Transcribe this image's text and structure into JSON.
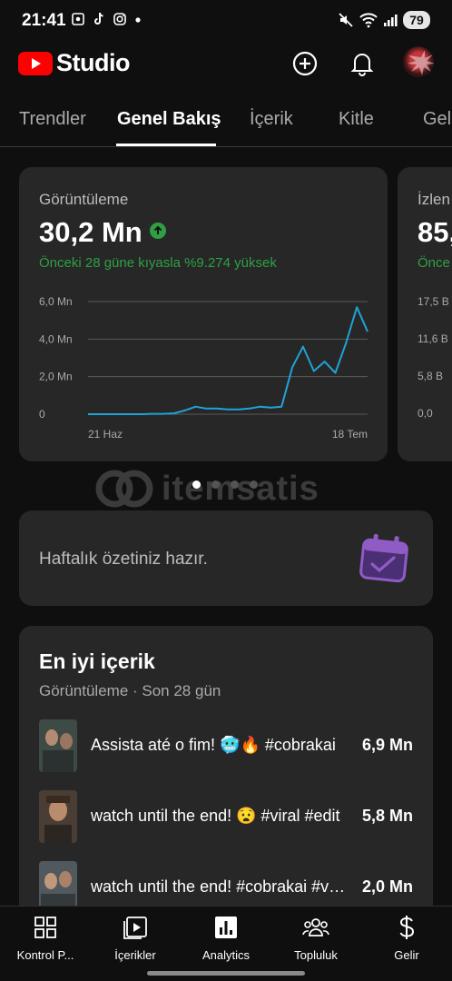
{
  "status_bar": {
    "time": "21:41",
    "battery": "79",
    "left_icons": [
      "screenshot-icon",
      "tiktok-icon",
      "instagram-icon",
      "dot-icon"
    ],
    "right_icons": [
      "mute-icon",
      "wifi-icon",
      "signal-icon"
    ]
  },
  "header": {
    "logo_text": "Studio",
    "brand_color": "#ff0000",
    "actions": [
      "create-icon",
      "notifications-icon",
      "avatar"
    ]
  },
  "tabs": [
    "Trendler",
    "Genel Bakış",
    "İçerik",
    "Kitle",
    "Gel"
  ],
  "active_tab": "Genel Bakış",
  "metric_card": {
    "label": "Görüntüleme",
    "value": "30,2 Mn",
    "trend_icon": "arrow-up-icon",
    "compare_text": "Önceki 28 güne kıyasla %9.274 yüksek",
    "accent_color": "#2ea043"
  },
  "peek_card": {
    "label": "İzlen",
    "value": "85,",
    "compare_text": "Önce",
    "ticks": [
      "17,5 B",
      "11,6 B",
      "5,8 B",
      "0,0"
    ]
  },
  "chart_data": {
    "type": "line",
    "color": "#1fa3d6",
    "grid": true,
    "y_ticks": [
      "6,0 Mn",
      "4,0 Mn",
      "2,0 Mn",
      "0"
    ],
    "ylim": [
      0,
      6.0
    ],
    "x_tick_labels": [
      "21 Haz",
      "18 Tem"
    ],
    "series": [
      {
        "values": [
          0.0,
          0.0,
          0.0,
          0.0,
          0.0,
          0.0,
          0.02,
          0.02,
          0.05,
          0.2,
          0.4,
          0.3,
          0.3,
          0.25,
          0.25,
          0.3,
          0.4,
          0.35,
          0.4,
          2.5,
          3.6,
          2.3,
          2.8,
          2.2,
          3.8,
          5.7,
          4.4
        ]
      }
    ]
  },
  "pager": {
    "count": 4,
    "active": 0
  },
  "watermark": "itemsatis",
  "summary": {
    "text": "Haftalık özetiniz hazır.",
    "icon": "calendar-check-icon",
    "icon_color": "#8e5cc4"
  },
  "top_content": {
    "title": "En iyi içerik",
    "subtitle": "Görüntüleme · Son 28 gün",
    "rows": [
      {
        "title": "Assista até o fim! 🥶🔥 #cobrakai",
        "value": "6,9 Mn"
      },
      {
        "title": "watch until the end! 😧 #viral #edit",
        "value": "5,8 Mn"
      },
      {
        "title": "watch until the end! #cobrakai #viral",
        "value": "2,0 Mn"
      }
    ]
  },
  "bottom_nav": [
    {
      "label": "Kontrol P...",
      "icon": "dashboard-icon"
    },
    {
      "label": "İçerikler",
      "icon": "content-icon"
    },
    {
      "label": "Analytics",
      "icon": "analytics-icon"
    },
    {
      "label": "Topluluk",
      "icon": "community-icon"
    },
    {
      "label": "Gelir",
      "icon": "dollar-icon"
    }
  ]
}
